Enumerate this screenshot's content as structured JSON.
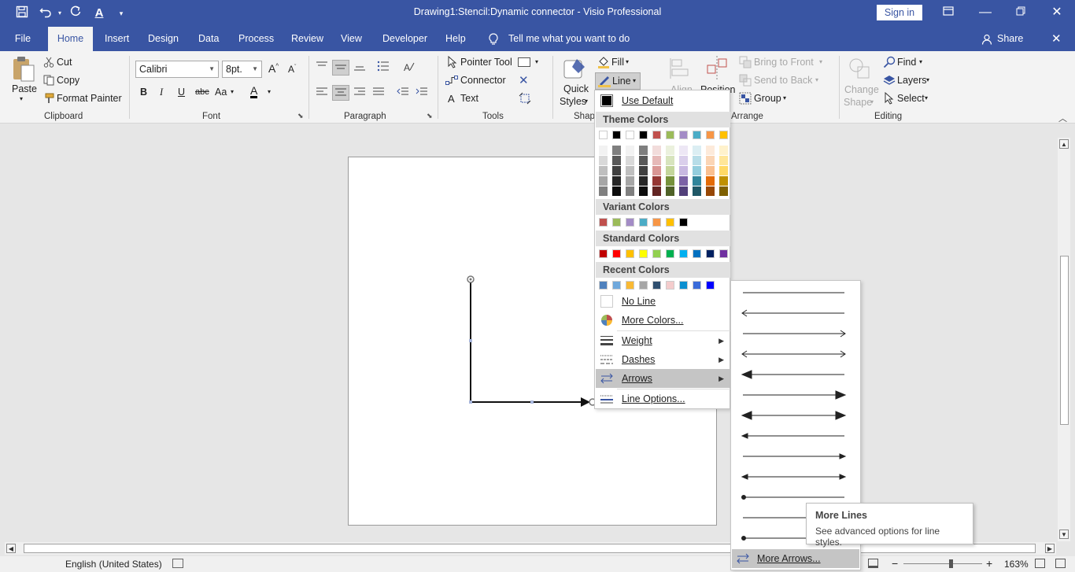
{
  "titlebar": {
    "title": "Drawing1:Stencil:Dynamic connector  -  Visio Professional",
    "sign_in": "Sign in",
    "qat_save": "save-icon",
    "qat_undo": "undo-icon",
    "qat_redo": "redo-icon",
    "qat_font_color": "A"
  },
  "tabs": [
    "File",
    "Home",
    "Insert",
    "Design",
    "Data",
    "Process",
    "Review",
    "View",
    "Developer",
    "Help"
  ],
  "tell_me": "Tell me what you want to do",
  "share": "Share",
  "ribbon": {
    "clipboard": {
      "paste": "Paste",
      "cut": "Cut",
      "copy": "Copy",
      "format_painter": "Format Painter",
      "label": "Clipboard"
    },
    "font": {
      "family": "Calibri",
      "size": "8pt.",
      "label": "Font",
      "bold": "B",
      "italic": "I",
      "underline": "U",
      "strike": "abc",
      "case": "Aa",
      "color": "A"
    },
    "paragraph": {
      "label": "Paragraph"
    },
    "tools": {
      "pointer": "Pointer Tool",
      "connector": "Connector",
      "text": "Text",
      "label": "Tools"
    },
    "shape_styles": {
      "quick_styles_1": "Quick",
      "quick_styles_2": "Styles",
      "fill": "Fill",
      "line": "Line",
      "label": "Shap"
    },
    "arrange": {
      "align": "Align",
      "position": "Position",
      "bring_to_front": "Bring to Front",
      "send_to_back": "Send to Back",
      "group": "Group",
      "label": "Arrange"
    },
    "editing": {
      "change_shape_1": "Change",
      "change_shape_2": "Shape",
      "find": "Find",
      "layers": "Layers",
      "select": "Select",
      "label": "Editing"
    }
  },
  "line_menu": {
    "use_default": "Use Default",
    "theme_colors": "Theme Colors",
    "variant_colors": "Variant Colors",
    "standard_colors": "Standard Colors",
    "recent_colors": "Recent Colors",
    "no_line": "No Line",
    "more_colors": "More Colors...",
    "weight": "Weight",
    "dashes": "Dashes",
    "arrows": "Arrows",
    "line_options": "Line Options...",
    "theme_top": [
      "#ffffff",
      "#000000",
      "#ffffff",
      "#000000",
      "#c0504d",
      "#9bbb59",
      "#a38cc6",
      "#4bacc6",
      "#f79646",
      "#ffc000"
    ],
    "theme_shades": [
      [
        "#f2f2f2",
        "#7f7f7f",
        "#f2f2f2",
        "#7f7f7f",
        "#f2dcdb",
        "#ebf1dd",
        "#ede7f5",
        "#dbeef3",
        "#fdeada",
        "#fff2cc"
      ],
      [
        "#d9d9d9",
        "#595959",
        "#d9d9d9",
        "#595959",
        "#e6b9b8",
        "#d7e4bd",
        "#dacfeb",
        "#b7dde8",
        "#fbd5b5",
        "#ffe699"
      ],
      [
        "#bfbfbf",
        "#404040",
        "#bfbfbf",
        "#404040",
        "#d99694",
        "#c3d69b",
        "#c8b8e1",
        "#93cddd",
        "#fac090",
        "#ffd966"
      ],
      [
        "#a6a6a6",
        "#262626",
        "#a6a6a6",
        "#262626",
        "#953734",
        "#76923c",
        "#7c62a6",
        "#31859b",
        "#e36c09",
        "#bf9000"
      ],
      [
        "#808080",
        "#0d0d0d",
        "#808080",
        "#0d0d0d",
        "#632523",
        "#4f6228",
        "#52407a",
        "#205867",
        "#974806",
        "#7f6000"
      ]
    ],
    "variant": [
      "#c0504d",
      "#9bbb59",
      "#a38cc6",
      "#4bacc6",
      "#f79646",
      "#ffc000",
      "#000000"
    ],
    "standard": [
      "#c00000",
      "#ff0000",
      "#ffc000",
      "#ffff00",
      "#92d050",
      "#00b050",
      "#00b0f0",
      "#0070c0",
      "#002060",
      "#7030a0"
    ],
    "recent": [
      "#4f81bd",
      "#6fa8dc",
      "#f9b934",
      "#a6a6a6",
      "#2f4f6f",
      "#f4cccc",
      "#0b8fd0",
      "#3a6bd9",
      "#0000ff"
    ]
  },
  "arrow_menu": {
    "more_arrows": "More Arrows..."
  },
  "tooltip": {
    "title": "More Lines",
    "description": "See advanced options for line styles."
  },
  "status": {
    "language": "English (United States)",
    "zoom": "163%"
  }
}
